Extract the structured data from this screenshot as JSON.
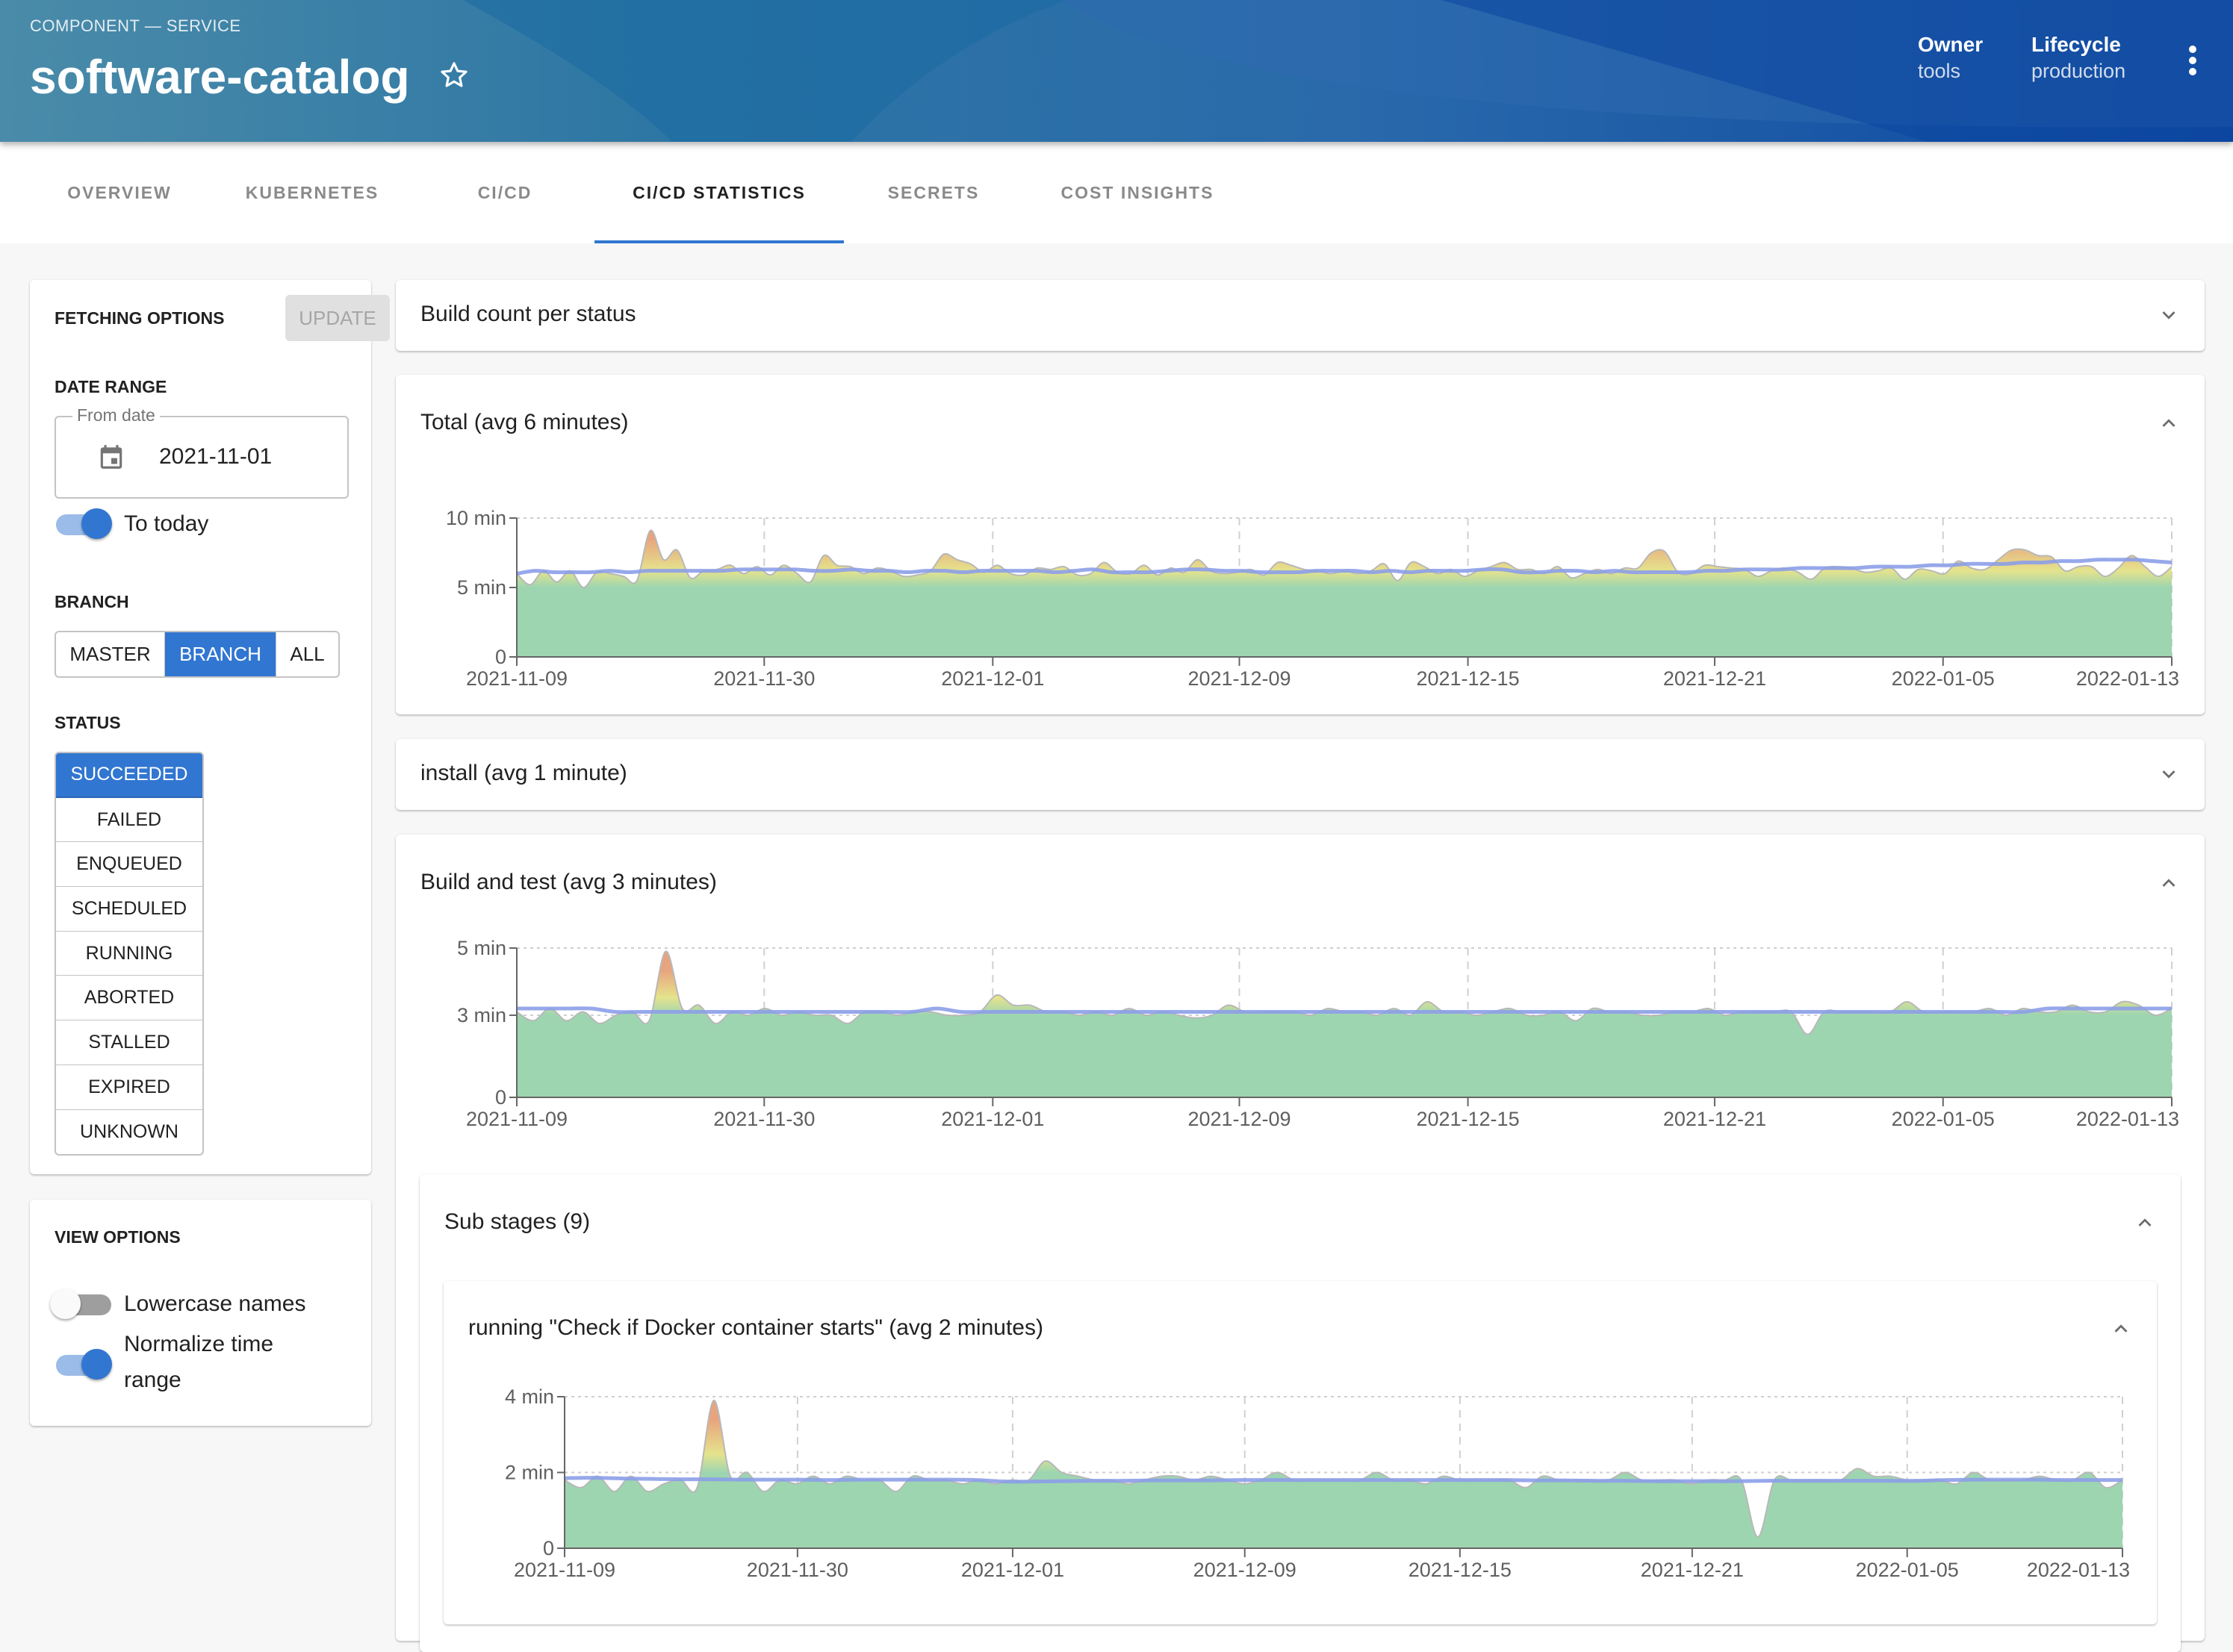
{
  "header": {
    "kind": "COMPONENT — SERVICE",
    "title": "software-catalog",
    "favorite_icon": "star-outline-icon",
    "meta": [
      {
        "key": "Owner",
        "value": "tools"
      },
      {
        "key": "Lifecycle",
        "value": "production"
      }
    ],
    "more_icon": "more-vert-icon"
  },
  "tabs": [
    {
      "label": "OVERVIEW",
      "active": false
    },
    {
      "label": "KUBERNETES",
      "active": false
    },
    {
      "label": "CI/CD",
      "active": false
    },
    {
      "label": "CI/CD STATISTICS",
      "active": true
    },
    {
      "label": "SECRETS",
      "active": false
    },
    {
      "label": "COST INSIGHTS",
      "active": false
    }
  ],
  "fetching": {
    "title": "FETCHING OPTIONS",
    "update_label": "UPDATE",
    "date_range_label": "DATE RANGE",
    "from_date_label": "From date",
    "from_date_value": "2021-11-01",
    "to_today_label": "To today",
    "to_today_on": true,
    "branch_label": "BRANCH",
    "branch_options": [
      "MASTER",
      "BRANCH",
      "ALL"
    ],
    "branch_selected": "BRANCH",
    "status_label": "STATUS",
    "status_options": [
      "SUCCEEDED",
      "FAILED",
      "ENQUEUED",
      "SCHEDULED",
      "RUNNING",
      "ABORTED",
      "STALLED",
      "EXPIRED",
      "UNKNOWN"
    ],
    "status_selected": [
      "SUCCEEDED"
    ]
  },
  "view_options": {
    "title": "VIEW OPTIONS",
    "lowercase_label": "Lowercase names",
    "lowercase_on": false,
    "normalize_label": "Normalize time range",
    "normalize_on": true
  },
  "colors": {
    "accent": "#3176d1",
    "area_low": "#9dd5b0",
    "area_mid": "#e5e38c",
    "area_high": "#e8a47e",
    "avg_line": "#8c9ee8"
  },
  "panels": {
    "build_count": {
      "title": "Build count per status",
      "expanded": false
    },
    "total": {
      "title": "Total (avg 6 minutes)",
      "expanded": true
    },
    "install": {
      "title": "install (avg 1 minute)",
      "expanded": false
    },
    "build_test": {
      "title": "Build and test (avg 3 minutes)",
      "expanded": true
    },
    "sub_stages": {
      "title": "Sub stages (9)",
      "expanded": true
    },
    "docker": {
      "title": "running \"Check if Docker container starts\" (avg 2 minutes)",
      "expanded": true
    }
  },
  "chart_data": [
    {
      "id": "total",
      "type": "area",
      "title": "Total (avg 6 minutes)",
      "xlabel": "",
      "ylabel": "",
      "x_ticks": [
        "2021-11-09",
        "2021-11-30",
        "2021-12-01",
        "2021-12-09",
        "2021-12-15",
        "2021-12-21",
        "2022-01-05",
        "2022-01-13"
      ],
      "y_ticks": [
        {
          "value": 0,
          "label": "0"
        },
        {
          "value": 5,
          "label": "5 min"
        },
        {
          "value": 10,
          "label": "10 min"
        }
      ],
      "ylim": [
        0,
        10
      ],
      "grid": true,
      "series": [
        {
          "name": "duration",
          "values": [
            6.0,
            5.2,
            6.2,
            5.4,
            6.2,
            5.0,
            6.1,
            6.0,
            5.8,
            5.5,
            9.1,
            7.0,
            7.7,
            5.7,
            6.2,
            6.3,
            6.6,
            6.0,
            6.5,
            5.9,
            6.6,
            6.0,
            5.4,
            7.3,
            6.6,
            6.5,
            6.0,
            6.4,
            6.2,
            5.8,
            5.9,
            6.2,
            7.4,
            7.0,
            6.7,
            6.1,
            6.6,
            6.0,
            5.9,
            6.4,
            6.3,
            6.5,
            5.9,
            6.0,
            6.8,
            6.1,
            6.0,
            6.6,
            5.9,
            6.4,
            6.1,
            7.0,
            6.2,
            6.0,
            6.1,
            6.3,
            5.9,
            6.8,
            6.6,
            6.3,
            6.2,
            6.0,
            6.2,
            6.0,
            6.2,
            6.7,
            5.5,
            6.8,
            6.5,
            6.0,
            6.3,
            5.8,
            6.2,
            6.5,
            6.8,
            6.3,
            6.3,
            6.0,
            6.5,
            5.7,
            6.0,
            6.3,
            6.0,
            6.4,
            6.4,
            7.5,
            7.6,
            6.1,
            6.0,
            6.6,
            6.5,
            6.4,
            6.3,
            5.8,
            6.2,
            6.4,
            6.1,
            5.6,
            6.4,
            6.5,
            6.4,
            6.1,
            6.2,
            6.4,
            5.6,
            6.3,
            6.2,
            6.0,
            6.9,
            6.4,
            6.3,
            7.0,
            7.7,
            7.7,
            7.3,
            7.2,
            6.2,
            6.5,
            6.5,
            5.8,
            6.4,
            7.3,
            6.5,
            5.8,
            6.5
          ]
        },
        {
          "name": "average",
          "values": [
            6.0,
            6.2,
            6.1,
            6.1,
            6.1,
            6.2,
            6.1,
            6.2,
            6.2,
            6.2,
            6.2,
            6.2,
            6.3,
            6.3,
            6.3,
            6.3,
            6.2,
            6.2,
            6.3,
            6.2,
            6.2,
            6.1,
            6.2,
            6.2,
            6.1,
            6.2,
            6.2,
            6.2,
            6.2,
            6.1,
            6.2,
            6.3,
            6.1,
            6.1,
            6.1,
            6.2,
            6.3,
            6.3,
            6.2,
            6.2,
            6.1,
            6.1,
            6.1,
            6.2,
            6.2,
            6.2,
            6.1,
            6.2,
            6.1,
            6.2,
            6.2,
            6.2,
            6.3,
            6.3,
            6.1,
            6.1,
            6.2,
            6.2,
            6.1,
            6.2,
            6.1,
            6.1,
            6.1,
            6.1,
            6.2,
            6.2,
            6.3,
            6.3,
            6.3,
            6.4,
            6.4,
            6.4,
            6.4,
            6.5,
            6.5,
            6.5,
            6.6,
            6.6,
            6.7,
            6.7,
            6.7,
            6.8,
            6.8,
            6.9,
            6.9,
            7.0,
            7.0,
            7.0,
            6.9,
            6.8
          ]
        }
      ]
    },
    {
      "id": "build_test",
      "type": "area",
      "title": "Build and test (avg 3 minutes)",
      "x_ticks": [
        "2021-11-09",
        "2021-11-30",
        "2021-12-01",
        "2021-12-09",
        "2021-12-15",
        "2021-12-21",
        "2022-01-05",
        "2022-01-13"
      ],
      "y_ticks": [
        {
          "value": 0,
          "label": "0"
        },
        {
          "value": 3,
          "label": "3 min"
        },
        {
          "value": 5,
          "label": "5 min"
        }
      ],
      "ylim": [
        0,
        5
      ],
      "grid": true,
      "series": [
        {
          "name": "duration",
          "values": [
            3.1,
            2.8,
            3.2,
            2.8,
            3.1,
            2.7,
            3.0,
            3.1,
            2.8,
            4.9,
            3.2,
            3.3,
            2.7,
            3.1,
            3.0,
            3.2,
            3.0,
            3.1,
            3.0,
            3.0,
            2.7,
            3.1,
            3.1,
            3.0,
            3.1,
            3.1,
            3.0,
            3.0,
            3.1,
            3.6,
            3.3,
            3.3,
            3.1,
            3.1,
            3.0,
            3.1,
            3.0,
            3.2,
            3.0,
            3.1,
            3.0,
            2.9,
            3.0,
            3.3,
            3.1,
            3.1,
            3.1,
            3.1,
            3.0,
            3.2,
            3.1,
            3.1,
            3.0,
            3.2,
            3.0,
            3.4,
            3.1,
            3.1,
            3.0,
            3.1,
            3.2,
            3.0,
            3.0,
            3.1,
            2.8,
            3.2,
            3.1,
            3.1,
            3.0,
            3.0,
            3.1,
            3.1,
            3.2,
            3.0,
            3.1,
            3.1,
            3.1,
            3.1,
            2.3,
            3.1,
            3.1,
            3.1,
            3.1,
            3.1,
            3.4,
            3.1,
            3.1,
            3.1,
            3.1,
            3.2,
            3.0,
            3.2,
            3.1,
            3.1,
            3.3,
            3.1,
            3.1,
            3.4,
            3.3,
            3.0,
            3.2
          ]
        },
        {
          "name": "average",
          "values": [
            3.2,
            3.2,
            3.2,
            3.2,
            3.1,
            3.1,
            3.1,
            3.1,
            3.1,
            3.1,
            3.1,
            3.1,
            3.1,
            3.1,
            3.1,
            3.1,
            3.1,
            3.2,
            3.1,
            3.1,
            3.1,
            3.1,
            3.1,
            3.1,
            3.1,
            3.1,
            3.1,
            3.1,
            3.1,
            3.1,
            3.1,
            3.1,
            3.1,
            3.1,
            3.1,
            3.1,
            3.1,
            3.1,
            3.1,
            3.1,
            3.1,
            3.1,
            3.1,
            3.1,
            3.1,
            3.1,
            3.1,
            3.1,
            3.1,
            3.1,
            3.1,
            3.1,
            3.1,
            3.1,
            3.1,
            3.1,
            3.1,
            3.1,
            3.1,
            3.1,
            3.1,
            3.1,
            3.2,
            3.2,
            3.2,
            3.2,
            3.2,
            3.2
          ]
        }
      ]
    },
    {
      "id": "docker",
      "type": "area",
      "title": "running \"Check if Docker container starts\" (avg 2 minutes)",
      "x_ticks": [
        "2021-11-09",
        "2021-11-30",
        "2021-12-01",
        "2021-12-09",
        "2021-12-15",
        "2021-12-21",
        "2022-01-05",
        "2022-01-13"
      ],
      "y_ticks": [
        {
          "value": 0,
          "label": "0"
        },
        {
          "value": 2,
          "label": "2 min"
        },
        {
          "value": 4,
          "label": "4 min"
        }
      ],
      "ylim": [
        0,
        4
      ],
      "grid": true,
      "series": [
        {
          "name": "duration",
          "values": [
            1.8,
            1.6,
            1.9,
            1.5,
            1.9,
            1.5,
            1.7,
            1.8,
            1.6,
            3.9,
            1.9,
            2.0,
            1.5,
            1.8,
            1.7,
            1.9,
            1.7,
            1.9,
            1.8,
            1.8,
            1.5,
            1.9,
            1.8,
            1.8,
            1.7,
            1.8,
            1.7,
            1.8,
            1.8,
            2.3,
            2.0,
            1.9,
            1.8,
            1.8,
            1.7,
            1.8,
            1.9,
            1.9,
            1.8,
            1.9,
            1.8,
            1.7,
            1.8,
            2.0,
            1.8,
            1.8,
            1.8,
            1.8,
            1.8,
            2.0,
            1.8,
            1.8,
            1.7,
            1.9,
            1.8,
            1.8,
            1.8,
            1.8,
            1.6,
            1.9,
            1.8,
            1.8,
            1.8,
            1.8,
            2.0,
            1.8,
            1.8,
            1.8,
            1.7,
            1.8,
            1.8,
            1.8,
            0.3,
            1.8,
            1.8,
            1.8,
            1.8,
            1.8,
            2.1,
            1.9,
            1.9,
            1.8,
            1.8,
            1.8,
            1.7,
            2.0,
            1.8,
            1.8,
            1.8,
            1.9,
            1.8,
            1.8,
            2.0,
            1.6,
            1.8
          ]
        },
        {
          "name": "average",
          "values": [
            1.85,
            1.86,
            1.84,
            1.83,
            1.82,
            1.82,
            1.81,
            1.81,
            1.81,
            1.8,
            1.81,
            1.81,
            1.81,
            1.81,
            1.8,
            1.76,
            1.76,
            1.77,
            1.78,
            1.78,
            1.79,
            1.79,
            1.79,
            1.8,
            1.8,
            1.8,
            1.8,
            1.8,
            1.8,
            1.8,
            1.8,
            1.8,
            1.8,
            1.79,
            1.79,
            1.78,
            1.78,
            1.77,
            1.77,
            1.77,
            1.77,
            1.78,
            1.78,
            1.78,
            1.78,
            1.78,
            1.78,
            1.8,
            1.81,
            1.81,
            1.81,
            1.8,
            1.8,
            1.8
          ]
        }
      ]
    }
  ]
}
